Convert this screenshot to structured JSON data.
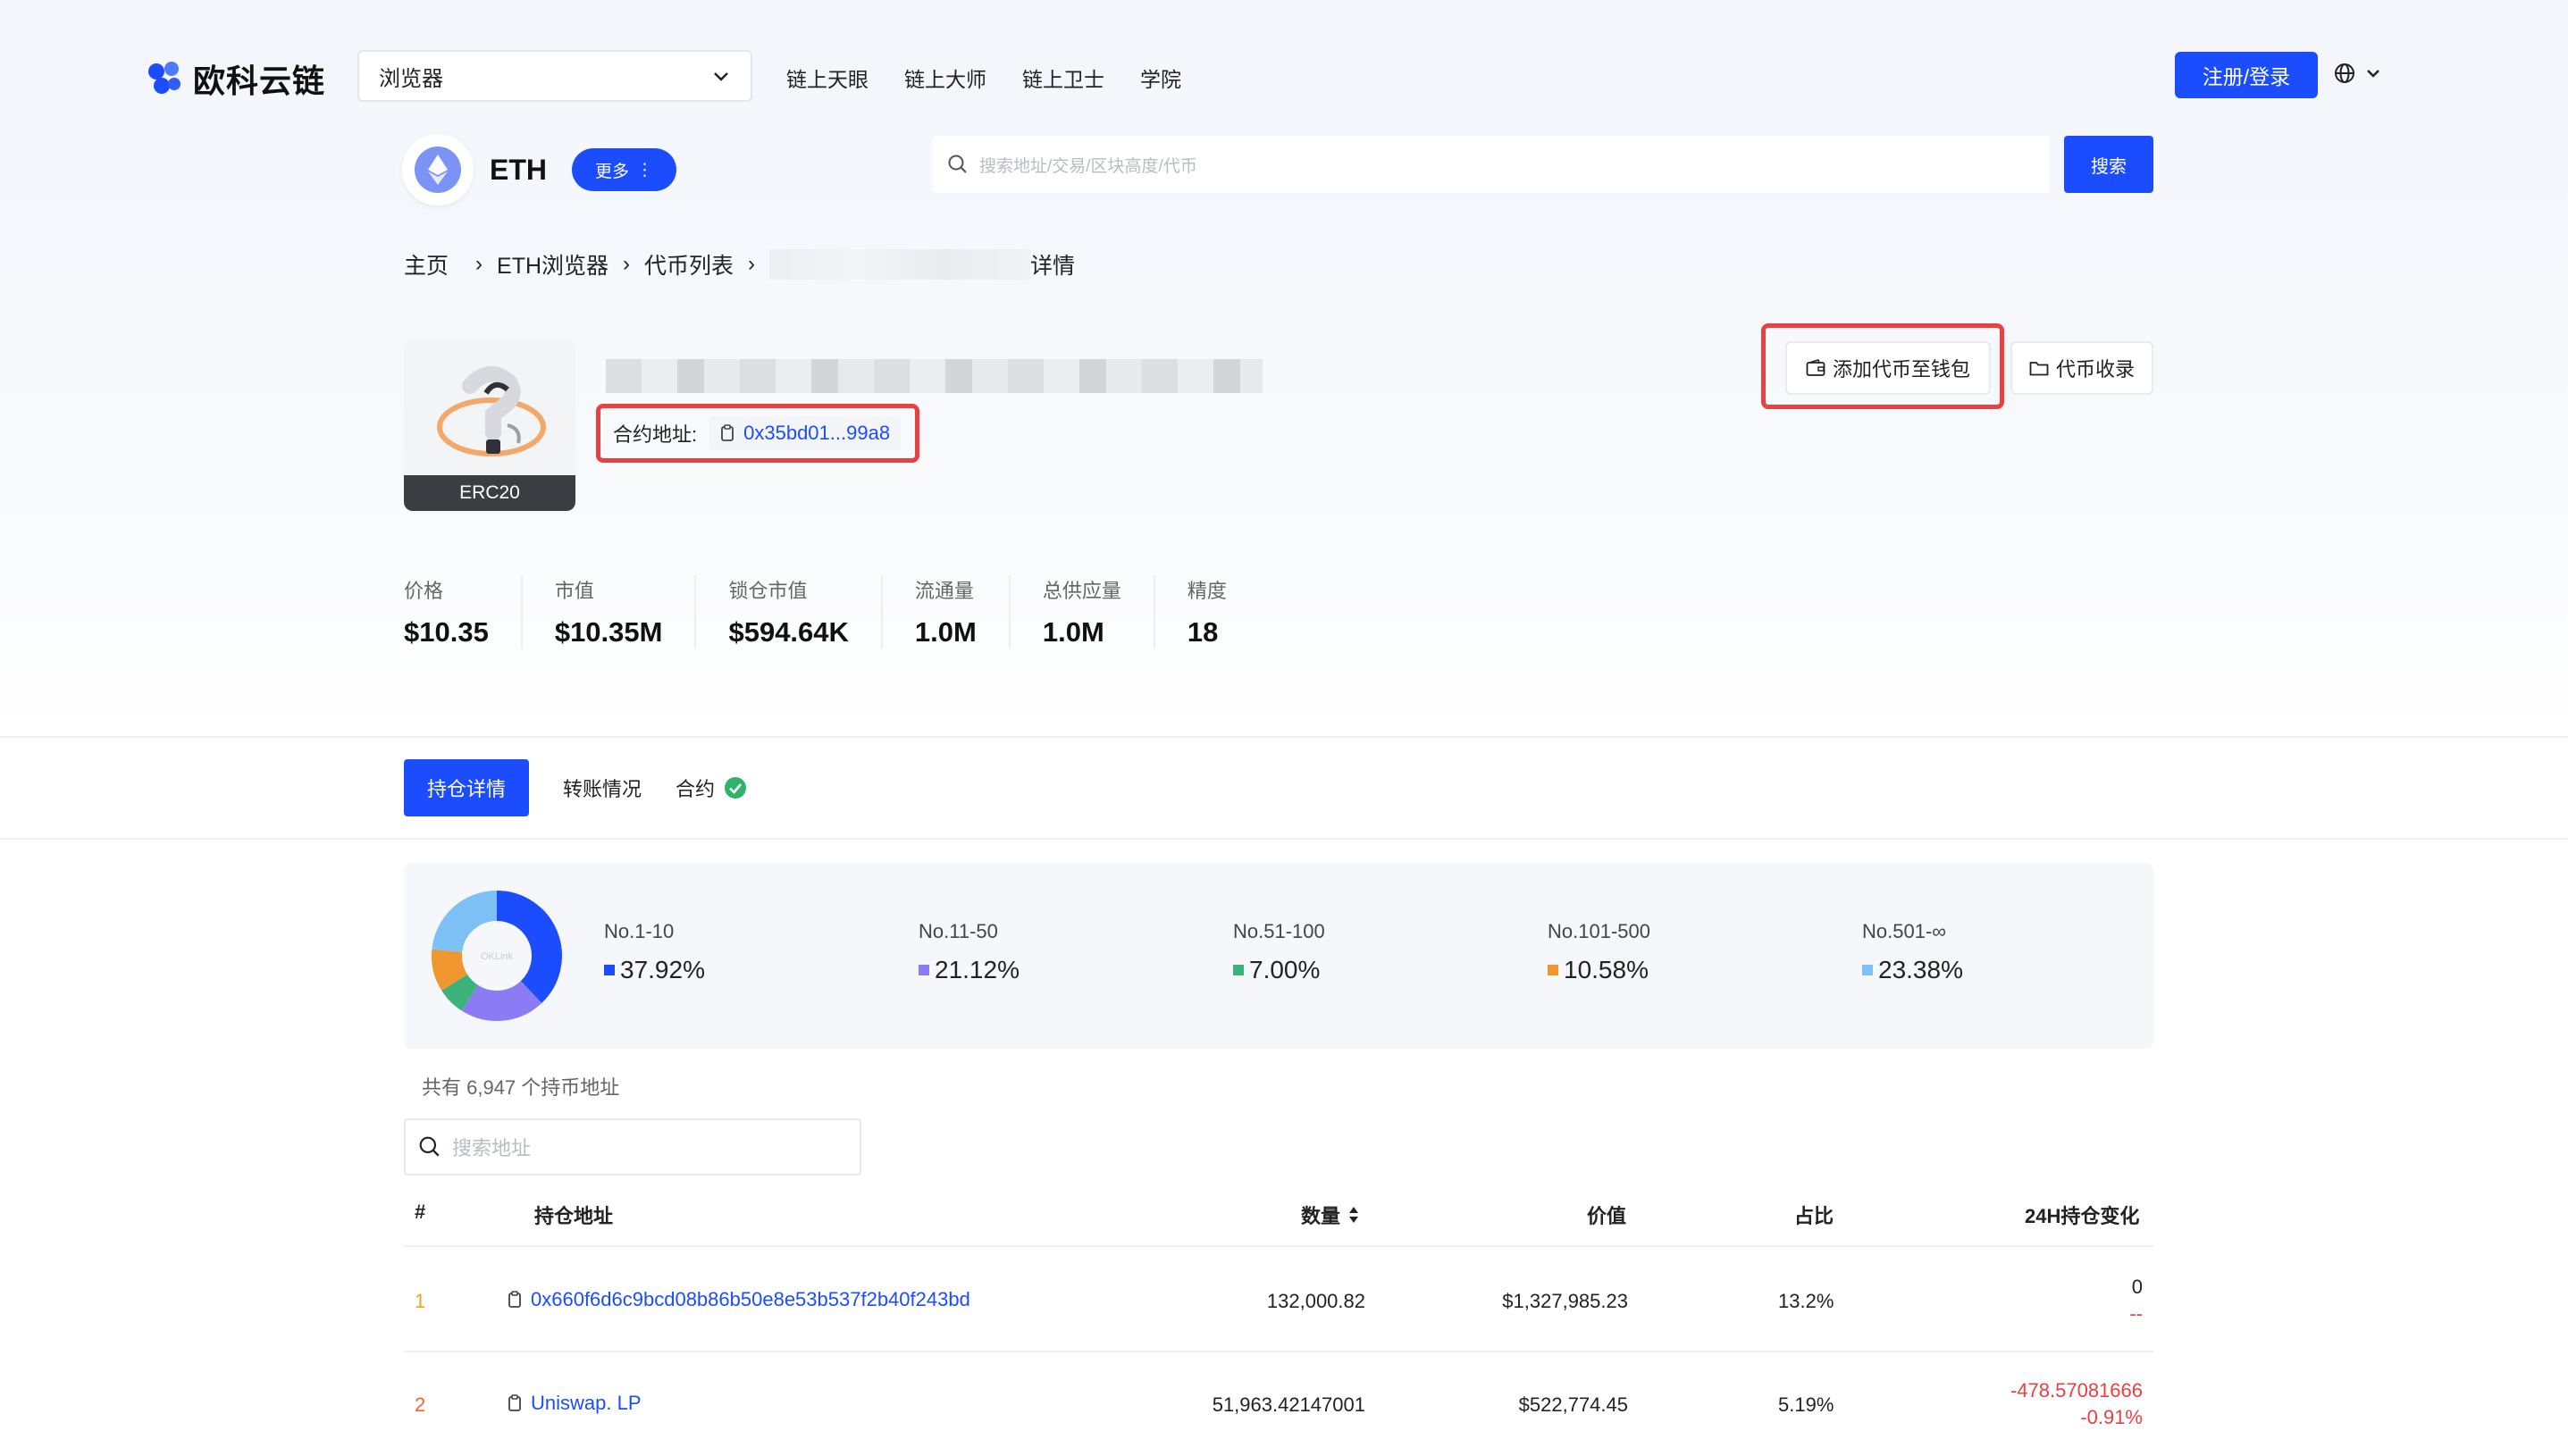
{
  "header": {
    "logo_text": "欧科云链",
    "selector_label": "浏览器",
    "nav": [
      "链上天眼",
      "链上大师",
      "链上卫士",
      "学院"
    ],
    "login_label": "注册/登录"
  },
  "chain": {
    "name": "ETH",
    "more_label": "更多",
    "search_placeholder": "搜索地址/交易/区块高度/代币",
    "search_button": "搜索"
  },
  "breadcrumb": {
    "home": "主页",
    "explorer": "ETH浏览器",
    "token_list": "代币列表",
    "detail": "详情"
  },
  "token": {
    "standard": "ERC20",
    "contract_label": "合约地址:",
    "contract_address": "0x35bd01...99a8",
    "add_wallet_label": "添加代币至钱包",
    "collect_label": "代币收录"
  },
  "stats": [
    {
      "label": "价格",
      "value": "$10.35"
    },
    {
      "label": "市值",
      "value": "$10.35M"
    },
    {
      "label": "锁仓市值",
      "value": "$594.64K"
    },
    {
      "label": "流通量",
      "value": "1.0M"
    },
    {
      "label": "总供应量",
      "value": "1.0M"
    },
    {
      "label": "精度",
      "value": "18"
    }
  ],
  "tabs": [
    "持仓详情",
    "转账情况",
    "合约"
  ],
  "distribution": {
    "center_label": "OKLink",
    "items": [
      {
        "label": "No.1-10",
        "value": "37.92%",
        "pct": 37.92,
        "color": "#1b4dff"
      },
      {
        "label": "No.11-50",
        "value": "21.12%",
        "pct": 21.12,
        "color": "#8b7cf6"
      },
      {
        "label": "No.51-100",
        "value": "7.00%",
        "pct": 7.0,
        "color": "#3ab27a"
      },
      {
        "label": "No.101-500",
        "value": "10.58%",
        "pct": 10.58,
        "color": "#f0962e"
      },
      {
        "label": "No.501-∞",
        "value": "23.38%",
        "pct": 23.38,
        "color": "#7cc0f5"
      }
    ]
  },
  "holders": {
    "count_text": "共有 6,947 个持币地址",
    "search_placeholder": "搜索地址",
    "columns": {
      "rank": "#",
      "address": "持仓地址",
      "amount": "数量",
      "value": "价值",
      "share": "占比",
      "change": "24H持仓变化"
    },
    "rows": [
      {
        "rank": "1",
        "address": "0x660f6d6c9bcd08b86b50e8e53b537f2b40f243bd",
        "amount": "132,000.82",
        "value": "$1,327,985.23",
        "share": "13.2%",
        "change": "0",
        "change_pct": "--"
      },
      {
        "rank": "2",
        "address": "Uniswap. LP",
        "amount": "51,963.42147001",
        "value": "$522,774.45",
        "share": "5.19%",
        "change": "-478.57081666",
        "change_pct": "-0.91%"
      }
    ]
  },
  "colors": {
    "accent": "#1b4dff",
    "highlight": "#e94040",
    "negative": "#e94040",
    "rank1": "#f0a51b",
    "rank2": "#f06a2e"
  }
}
